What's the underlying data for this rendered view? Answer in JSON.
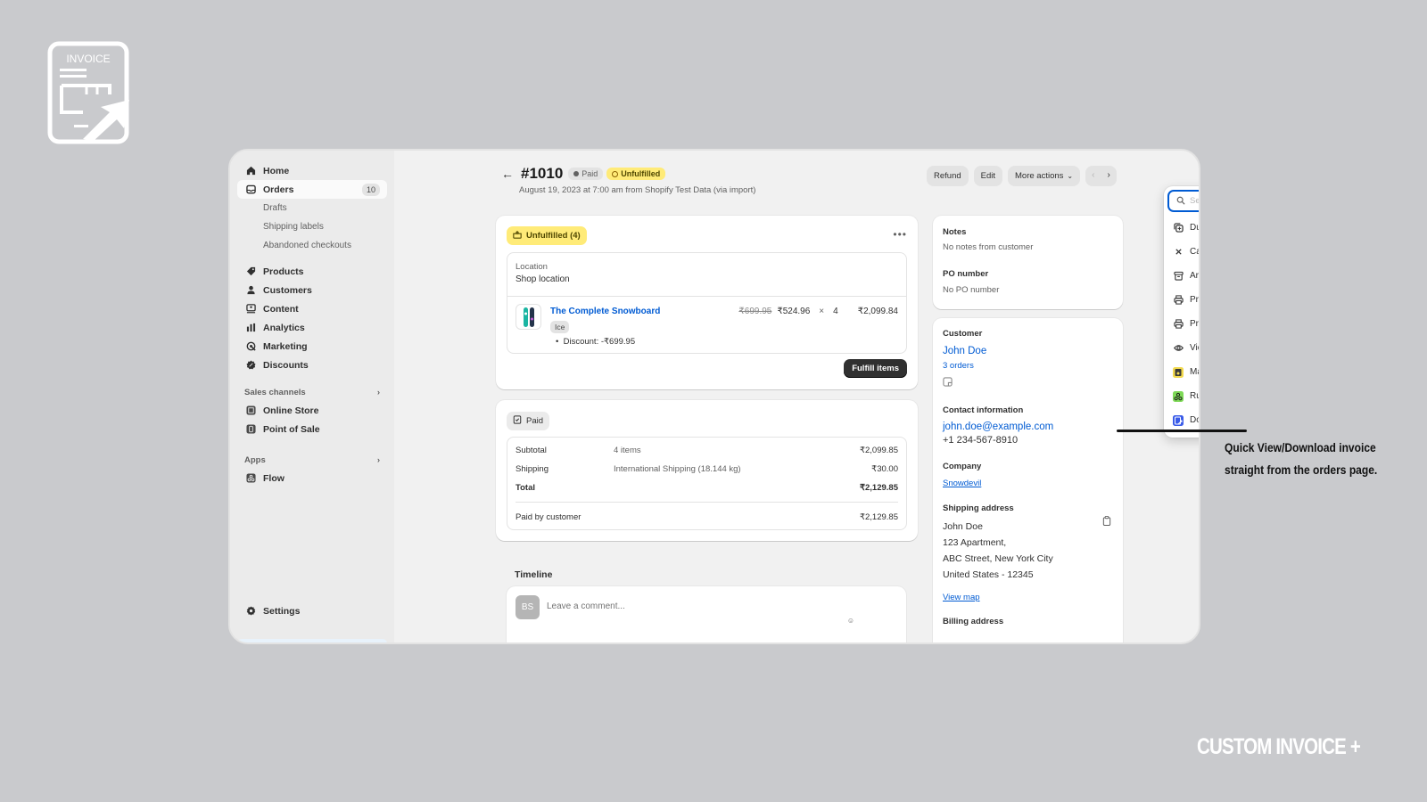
{
  "branding": {
    "logo_text": "INVOICE",
    "product_name": "CUSTOM INVOICE +",
    "callout_lines": [
      "Quick View/Download invoice",
      "straight from the orders page."
    ]
  },
  "sidebar": {
    "items": [
      {
        "label": "Home",
        "icon": "home-icon"
      },
      {
        "label": "Orders",
        "icon": "orders-icon",
        "badge": "10",
        "active": true
      },
      {
        "label": "Products",
        "icon": "tag-icon"
      },
      {
        "label": "Customers",
        "icon": "person-icon"
      },
      {
        "label": "Content",
        "icon": "content-icon"
      },
      {
        "label": "Analytics",
        "icon": "bar-chart-icon"
      },
      {
        "label": "Marketing",
        "icon": "target-icon"
      },
      {
        "label": "Discounts",
        "icon": "discount-icon"
      }
    ],
    "order_subitems": [
      "Drafts",
      "Shipping labels",
      "Abandoned checkouts"
    ],
    "sales_channels": {
      "heading": "Sales channels",
      "items": [
        {
          "label": "Online Store",
          "icon": "store-icon"
        },
        {
          "label": "Point of Sale",
          "icon": "pos-icon"
        }
      ]
    },
    "apps": {
      "heading": "Apps",
      "items": [
        {
          "label": "Flow",
          "icon": "flow-icon"
        }
      ]
    },
    "settings_label": "Settings"
  },
  "order": {
    "number": "#1010",
    "payment_status": "Paid",
    "fulfillment_status": "Unfulfilled",
    "subtitle": "August 19, 2023 at 7:00 am from Shopify Test Data (via import)"
  },
  "toolbar": {
    "refund": "Refund",
    "edit": "Edit",
    "more_actions": "More actions"
  },
  "fulfillment_card": {
    "tag": "Unfulfilled (4)",
    "location_label": "Location",
    "location_value": "Shop location",
    "product": {
      "name": "The Complete Snowboard",
      "variant": "Ice",
      "discount": "Discount: -₹699.95",
      "original_price": "₹699.95",
      "price": "₹524.96",
      "times": "×",
      "quantity": "4",
      "line_total": "₹2,099.84"
    },
    "fulfill_button": "Fulfill items"
  },
  "payment_card": {
    "tag": "Paid",
    "rows": [
      {
        "label": "Subtotal",
        "detail": "4 items",
        "amount": "₹2,099.85"
      },
      {
        "label": "Shipping",
        "detail": "International Shipping (18.144 kg)",
        "amount": "₹30.00"
      },
      {
        "label": "Total",
        "detail": "",
        "amount": "₹2,129.85"
      }
    ],
    "paid_by_label": "Paid by customer",
    "paid_by_amount": "₹2,129.85"
  },
  "timeline": {
    "heading": "Timeline",
    "avatar_initials": "BS",
    "comment_placeholder": "Leave a comment..."
  },
  "notes_card": {
    "notes_heading": "Notes",
    "notes_text": "No notes from customer",
    "po_heading": "PO number",
    "po_text": "No PO number"
  },
  "customer_card": {
    "heading": "Customer",
    "name": "John Doe",
    "orders": "3 orders",
    "contact_heading": "Contact information",
    "email": "john.doe@example.com",
    "phone": "+1 234-567-8910",
    "company_heading": "Company",
    "company": "Snowdevil",
    "shipping_heading": "Shipping address",
    "shipping_lines": [
      "John Doe",
      "123 Apartment,",
      "ABC Street, New York City",
      "United States - 12345"
    ],
    "view_map": "View map",
    "billing_heading": "Billing address"
  },
  "actions_menu": {
    "search_placeholder": "Search actions",
    "items": [
      {
        "label": "Duplicate",
        "icon": "duplicate-icon"
      },
      {
        "label": "Cancel order",
        "icon": "close-icon"
      },
      {
        "label": "Archive",
        "icon": "archive-icon"
      },
      {
        "label": "Print order page",
        "icon": "printer-icon"
      },
      {
        "label": "Print packing slips",
        "icon": "printer-icon"
      },
      {
        "label": "View order status page",
        "icon": "eye-icon"
      },
      {
        "label": "Mark as paid with cash",
        "icon": "cash-app-icon"
      },
      {
        "label": "Run Flow automation",
        "icon": "flow-app-icon"
      },
      {
        "label": "Download Invoice",
        "icon": "invoice-app-icon"
      }
    ]
  },
  "colors": {
    "accent_blue": "#005bd3",
    "warning_yellow": "#ffeb78",
    "page_background": "#c9cacd"
  }
}
